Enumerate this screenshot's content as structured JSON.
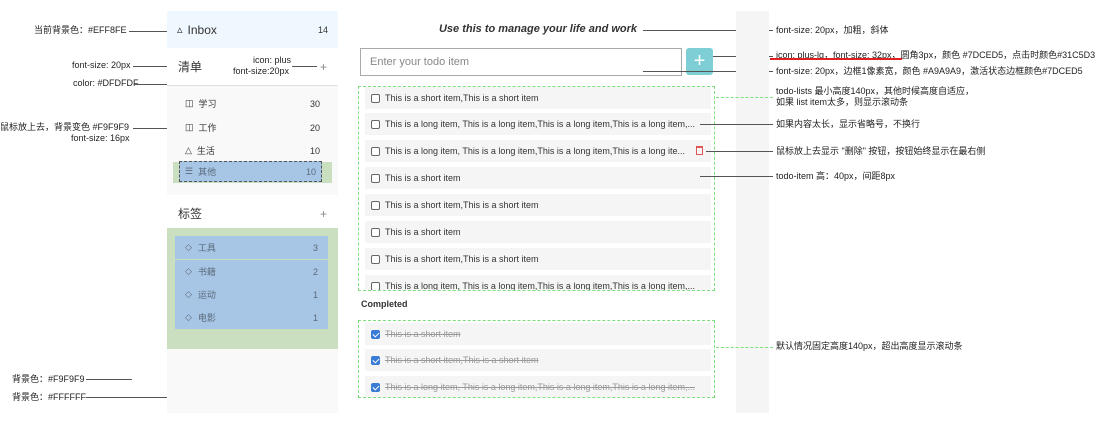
{
  "annotations": {
    "bg_current": "当前背景色：#EFF8FE",
    "fs_20": "font-size: 20px",
    "color_dfdfdf": "color: #DFDFDF",
    "hover_bg": "鼠标放上去，背景变色 #F9F9F9",
    "fs_16": "font-size: 16px",
    "bg_f9": "背景色：#F9F9F9",
    "bg_ff": "背景色：#FFFFFF",
    "icon_plus": "icon: plus",
    "icon_plus_fs": "font-size:20px",
    "title_style": "font-size: 20px，加粗，斜体",
    "btn_style": "icon: plus-lg，font-size: 32px，圆角3px，颜色 #7DCED5，点击时颜色#31C5D3",
    "input_style": "font-size: 20px，边框1像素宽，颜色 #A9A9A9，激活状态边框颜色#7DCED5",
    "list_style_1": "todo-lists 最小高度140px，其他时候高度自适应，",
    "list_style_2": "如果 list item太多，则显示滚动条",
    "ellipsis": "如果内容太长，显示省略号，不换行",
    "delete_btn": "鼠标放上去显示 \"删除\" 按钮，按钮始终显示在最右侧",
    "item_height": "todo-item 高：40px，间距8px",
    "completed_height": "默认情况固定高度140px，超出高度显示滚动条"
  },
  "sidebar": {
    "inbox": {
      "label": "Inbox",
      "count": "14"
    },
    "lists_header": "清单",
    "lists": [
      {
        "label": "学习",
        "count": "30",
        "icon": "book-icon"
      },
      {
        "label": "工作",
        "count": "20",
        "icon": "briefcase-icon"
      },
      {
        "label": "生活",
        "count": "10",
        "icon": "recycle-icon"
      },
      {
        "label": "其他",
        "count": "10",
        "icon": "list-icon"
      }
    ],
    "tags_header": "标签",
    "tags": [
      {
        "label": "工具",
        "count": "3"
      },
      {
        "label": "书籍",
        "count": "2"
      },
      {
        "label": "运动",
        "count": "1"
      },
      {
        "label": "电影",
        "count": "1"
      }
    ]
  },
  "main": {
    "title": "Use this to manage your life and work",
    "input_placeholder": "Enter your todo item",
    "add_icon": "+",
    "todos": [
      "This is a short item,This is a short item",
      "This is a long item, This is a long item,This is a long item,This is a long item,...",
      "This is a long item, This is a long item,This is a long item,This is a long ite...",
      "This is a short item",
      "This is a short item,This is a short item",
      "This is a short item",
      "This is a short item,This is a short item",
      "This is a long item, This is a long item,This is a long item,This is a long item,..."
    ],
    "completed_label": "Completed",
    "completed": [
      "This is a short item",
      "This is a short item,This is a short item",
      "This is a long item, This is a long item,This is a long item,This is a long item,..."
    ]
  },
  "colors": {
    "accent": "#7DCED5",
    "inbox_bg": "#EFF8FE",
    "sidebar_bg": "#F9F9F9"
  }
}
